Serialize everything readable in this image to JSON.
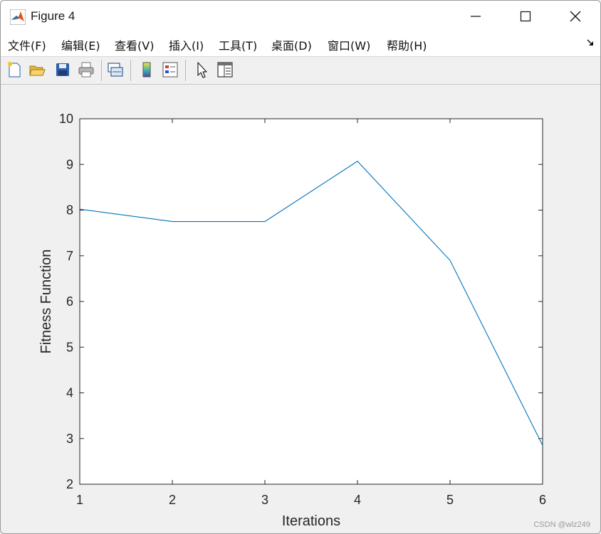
{
  "window": {
    "title": "Figure 4"
  },
  "menu": {
    "items": [
      {
        "label": "文件(F)"
      },
      {
        "label": "编辑(E)"
      },
      {
        "label": "查看(V)"
      },
      {
        "label": "插入(I)"
      },
      {
        "label": "工具(T)"
      },
      {
        "label": "桌面(D)"
      },
      {
        "label": "窗口(W)"
      },
      {
        "label": "帮助(H)"
      }
    ]
  },
  "toolbar": {
    "icons": [
      "new-figure-icon",
      "open-file-icon",
      "save-icon",
      "print-icon",
      "link-plot-icon",
      "colorbar-icon",
      "legend-icon",
      "edit-plot-icon",
      "property-inspector-icon"
    ]
  },
  "chart_data": {
    "type": "line",
    "title": "",
    "xlabel": "Iterations",
    "ylabel": "Fitness Function",
    "x": [
      1,
      2,
      3,
      4,
      5,
      6
    ],
    "series": [
      {
        "values": [
          8.02,
          7.75,
          7.75,
          9.07,
          6.9,
          2.85
        ]
      }
    ],
    "xlim": [
      1,
      6
    ],
    "ylim": [
      2,
      10
    ],
    "xticks": [
      "1",
      "2",
      "3",
      "4",
      "5",
      "6"
    ],
    "yticks": [
      "2",
      "3",
      "4",
      "5",
      "6",
      "7",
      "8",
      "9",
      "10"
    ],
    "line_color": "#0072BD",
    "grid": false
  },
  "watermark": "CSDN @wlz249"
}
